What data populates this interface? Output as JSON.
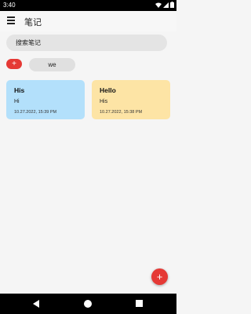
{
  "status_bar": {
    "time": "3:40",
    "icons": [
      "wifi-icon",
      "signal-icon",
      "battery-icon"
    ]
  },
  "app_bar": {
    "title": "笔记",
    "menu_icon": "hamburger-menu-icon"
  },
  "search": {
    "placeholder": "搜索笔记"
  },
  "tags": {
    "add_label": "+",
    "items": [
      "we"
    ]
  },
  "notes": [
    {
      "title": "His",
      "body": "Hi",
      "date": "10.27.2022, 15:39 PM",
      "color": "#b3e0fb"
    },
    {
      "title": "Hello",
      "body": "His",
      "date": "10.27.2022, 15:38 PM",
      "color": "#fde4a5"
    }
  ],
  "fab": {
    "label": "+"
  },
  "colors": {
    "accent": "#e53935",
    "background": "#f5f5f5"
  }
}
